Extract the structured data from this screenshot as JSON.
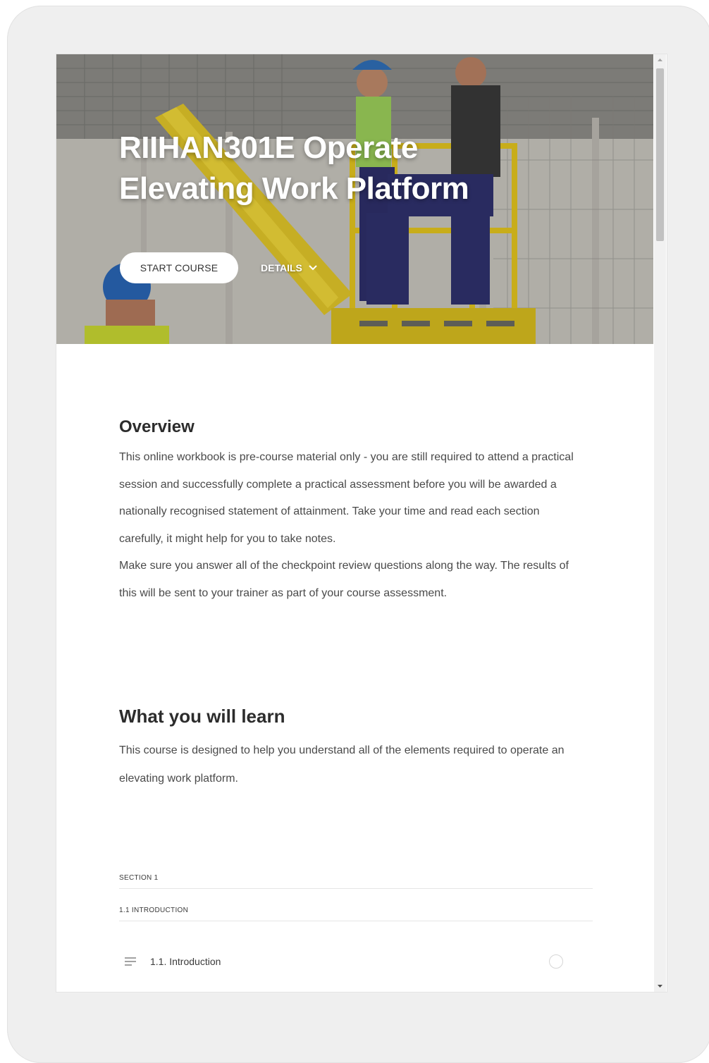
{
  "course": {
    "title": "RIIHAN301E Operate Elevating Work Platform",
    "start_label": "START COURSE",
    "details_label": "DETAILS"
  },
  "overview": {
    "heading": "Overview",
    "paragraphs": [
      "This online workbook is pre-course material only - you are still required to attend a practical session and successfully complete a practical assessment before you will be awarded a nationally recognised statement of attainment. Take your time and read each section carefully, it might help for you to take notes.",
      "Make sure you answer all of the checkpoint review questions along the way. The results of this will be sent to your trainer as part of your course assessment."
    ]
  },
  "learn": {
    "heading": "What you will learn",
    "body": "This course is designed to help you understand all of the elements required to operate an elevating work platform."
  },
  "outline": {
    "section_label": "SECTION 1",
    "subsection_label": "1.1 INTRODUCTION",
    "lesson_label": "1.1. Introduction"
  },
  "icons": {
    "lesson": "text-lines-icon",
    "details": "chevron-down-icon",
    "status": "empty-circle-icon"
  }
}
